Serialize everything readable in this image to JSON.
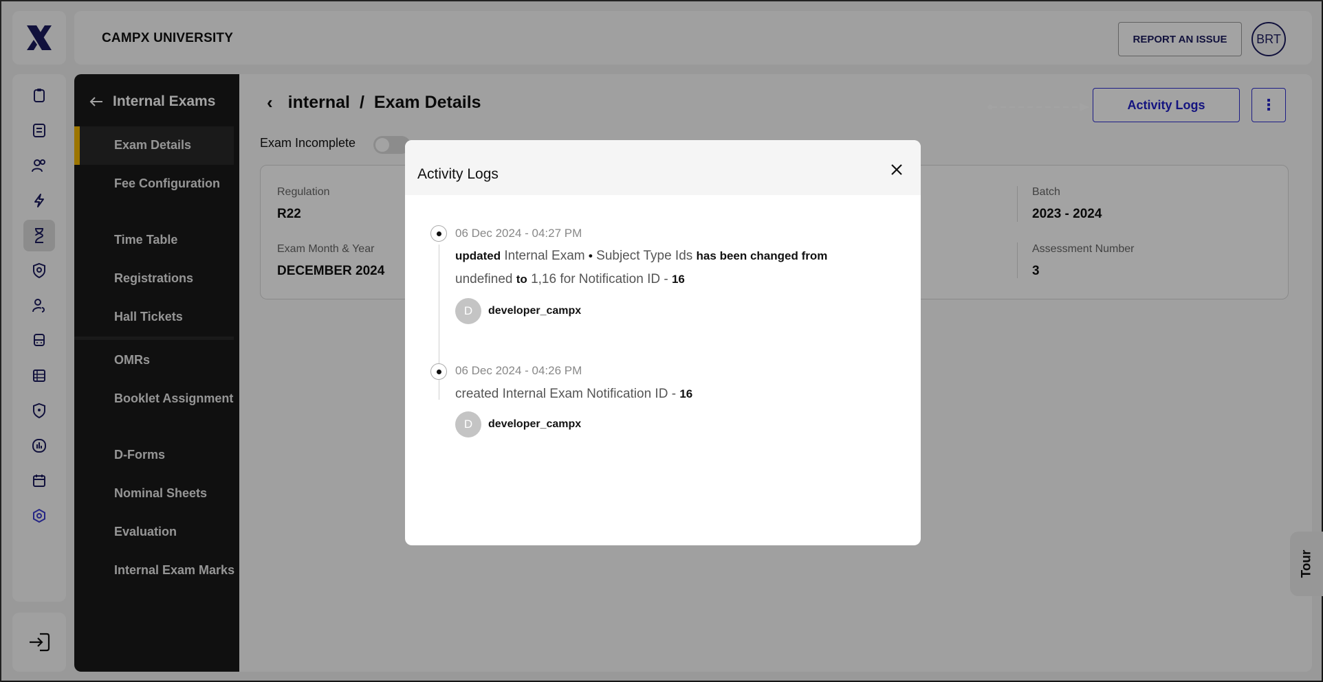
{
  "header": {
    "university": "CAMPX UNIVERSITY",
    "report_label": "REPORT AN ISSUE",
    "avatar_initials": "BRT"
  },
  "rail": {
    "icons": [
      "clipboard-icon",
      "document-icon",
      "users-icon",
      "bolt-icon",
      "hourglass-icon",
      "shield-badge-icon",
      "user-refresh-icon",
      "bus-icon",
      "spreadsheet-icon",
      "location-shield-icon",
      "chart-icon",
      "calendar-icon",
      "settings-hex-icon"
    ],
    "active_index": 4,
    "logout_icon": "logout-icon"
  },
  "sidebar": {
    "title": "Internal Exams",
    "items": [
      {
        "label": "Exam Details",
        "active": true
      },
      {
        "label": "Fee Configuration"
      },
      {
        "label": "Time Table"
      },
      {
        "label": "Registrations"
      },
      {
        "label": "Hall Tickets"
      },
      {
        "label": "OMRs"
      },
      {
        "label": "Booklet Assignment"
      },
      {
        "label": "D-Forms"
      },
      {
        "label": "Nominal Sheets"
      },
      {
        "label": "Evaluation"
      },
      {
        "label": "Internal Exam Marks"
      }
    ],
    "accent_color": "#f5b800"
  },
  "main": {
    "breadcrumb": {
      "parent": "internal",
      "separator": "/",
      "current": "Exam Details"
    },
    "activity_button": "Activity Logs",
    "exam_incomplete_label": "Exam Incomplete",
    "exam_incomplete_on": false,
    "fields": {
      "regulation": {
        "label": "Regulation",
        "value": "R22"
      },
      "batch": {
        "label": "Batch",
        "value": "2023 - 2024"
      },
      "exam_month_year": {
        "label": "Exam Month & Year",
        "value": "DECEMBER 2024"
      },
      "assessment_number": {
        "label": "Assessment Number",
        "value": "3"
      }
    },
    "tour_label": "Tour",
    "accent_color": "#2020c8"
  },
  "modal": {
    "title": "Activity Logs",
    "entries": [
      {
        "time": "06 Dec 2024 - 04:27 PM",
        "action": "updated",
        "entity": "Internal Exam",
        "bullet": "•",
        "field": "Subject Type Ids",
        "changed_text": "has been changed from",
        "from": "undefined",
        "to_word": "to",
        "to": "1,16",
        "for_text": "for Notification ID -",
        "id": "16",
        "user_initial": "D",
        "user": "developer_campx"
      },
      {
        "time": "06 Dec 2024 - 04:26 PM",
        "action": "created Internal Exam Notification ID -",
        "id": "16",
        "user_initial": "D",
        "user": "developer_campx"
      }
    ]
  }
}
